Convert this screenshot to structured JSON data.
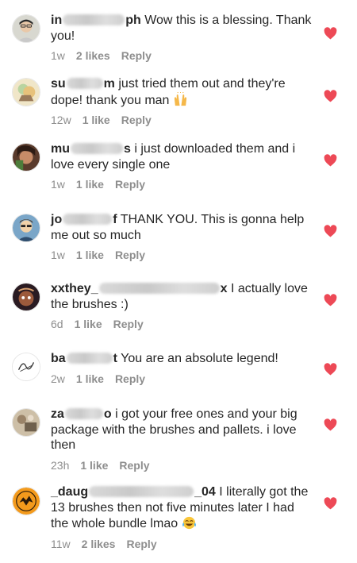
{
  "colors": {
    "heart": "#ed4956",
    "text": "#262626",
    "meta": "#8e8e8e"
  },
  "comments": [
    {
      "username_start": "in",
      "username_end": "ph",
      "text": "Wow this is a blessing. Thank you!",
      "age": "1w",
      "likes": "2 likes",
      "reply": "Reply",
      "emoji": ""
    },
    {
      "username_start": "su",
      "username_end": "m",
      "text": "just tried them out and they're dope! thank you man",
      "age": "12w",
      "likes": "1 like",
      "reply": "Reply",
      "emoji": "raising-hands-emoji"
    },
    {
      "username_start": "mu",
      "username_end": "s",
      "text": "i just downloaded them and i love every single one",
      "age": "1w",
      "likes": "1 like",
      "reply": "Reply",
      "emoji": ""
    },
    {
      "username_start": "jo",
      "username_end": "f",
      "text": "THANK YOU. This is gonna help me out so much",
      "age": "1w",
      "likes": "1 like",
      "reply": "Reply",
      "emoji": ""
    },
    {
      "username_start": "xxthey_",
      "username_end": "x",
      "text": "I actually love the brushes :)",
      "age": "6d",
      "likes": "1 like",
      "reply": "Reply",
      "emoji": ""
    },
    {
      "username_start": "ba",
      "username_end": "t",
      "text": "You are an absolute legend!",
      "age": "2w",
      "likes": "1 like",
      "reply": "Reply",
      "emoji": ""
    },
    {
      "username_start": "za",
      "username_end": "o",
      "text": "i got your free ones and your big package with the brushes and pallets. i love then",
      "age": "23h",
      "likes": "1 like",
      "reply": "Reply",
      "emoji": ""
    },
    {
      "username_start": "_daug",
      "username_end": "_04",
      "text": "I literally got the 13 brushes then not five minutes later I had the whole bundle lmao",
      "age": "11w",
      "likes": "2 likes",
      "reply": "Reply",
      "emoji": "laughing-tears-emoji"
    }
  ]
}
